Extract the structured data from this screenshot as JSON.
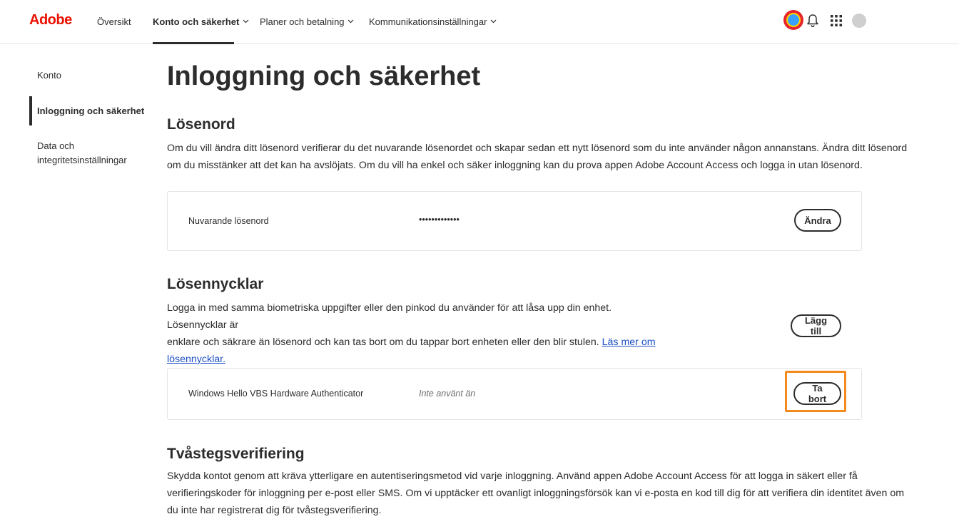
{
  "header": {
    "logo": "Adobe",
    "nav": [
      {
        "label": "Översikt"
      },
      {
        "label": "Konto och säkerhet"
      },
      {
        "label": "Planer och betalning"
      },
      {
        "label": "Kommunikationsinställningar"
      }
    ]
  },
  "sidebar": {
    "items": [
      {
        "label": "Konto"
      },
      {
        "label": "Inloggning och säkerhet"
      },
      {
        "label_line1": "Data och",
        "label_line2": "integritetsinställningar"
      }
    ]
  },
  "main": {
    "title": "Inloggning och säkerhet",
    "password": {
      "heading": "Lösenord",
      "description_line1": "Om du vill ändra ditt lösenord verifierar du det nuvarande lösenordet och skapar sedan ett nytt lösenord som du inte använder någon annanstans. Ändra ditt lösenord",
      "description_line2": "om du misstänker att det kan ha avslöjats. Om du vill ha enkel och säker inloggning kan du prova appen Adobe Account Access och logga in utan lösenord.",
      "current_label": "Nuvarande lösenord",
      "current_value": "•••••••••••••",
      "change_button": "Ändra"
    },
    "passkeys": {
      "heading": "Lösennycklar",
      "description_line1": "Logga in med samma biometriska uppgifter eller den pinkod du använder för att låsa upp din enhet. Lösennycklar är",
      "description_line2": "enklare och säkrare än lösenord och kan tas bort om du tappar bort enheten eller den blir stulen.",
      "link_part1": "Läs mer om",
      "link_part2": "lösennycklar.",
      "add_button": "Lägg till",
      "device_name": "Windows Hello VBS Hardware Authenticator",
      "device_status": "Inte använt än",
      "remove_button": "Ta bort"
    },
    "two_step": {
      "heading": "Tvåstegsverifiering",
      "description_line1": "Skydda kontot genom att kräva ytterligare en autentiseringsmetod vid varje inloggning. Använd appen Adobe Account Access för att logga in säkert eller få",
      "description_line2": "verifieringskoder för inloggning per e-post eller SMS. Om vi upptäcker ett ovanligt inloggningsförsök kan vi e-posta en kod till dig för att verifiera din identitet även om",
      "description_line3": "du inte har registrerat dig för tvåstegsverifiering."
    }
  },
  "icons": {
    "chevron": "chevron-down-icon",
    "bell": "bell-icon",
    "apps": "apps-grid-icon"
  },
  "colors": {
    "brand": "#eb1000",
    "highlight": "#f28a1e",
    "link": "#1b4fc4"
  }
}
